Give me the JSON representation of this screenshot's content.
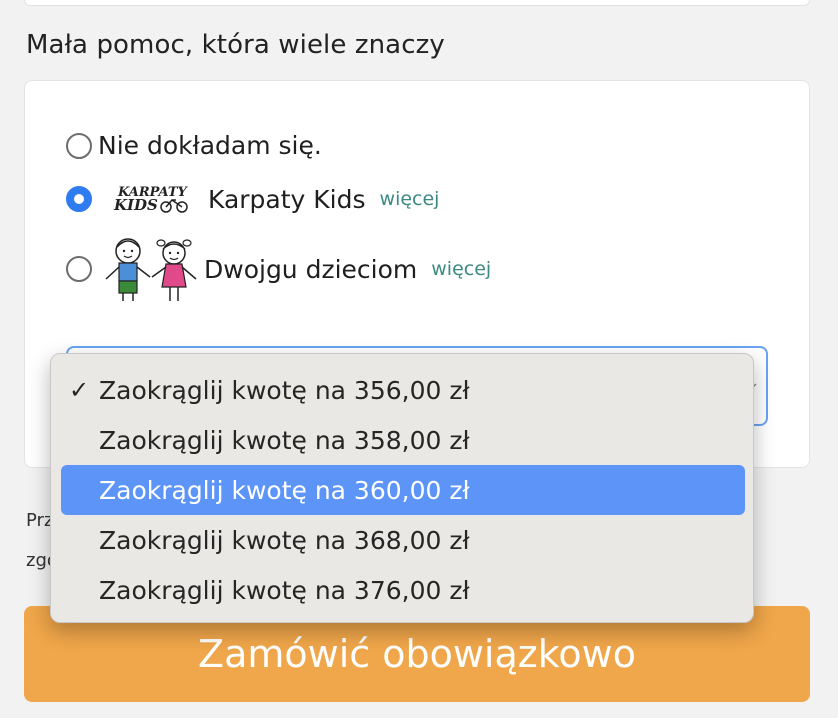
{
  "section": {
    "title": "Mała pomoc, która wiele znaczy"
  },
  "donation": {
    "options": [
      {
        "label": "Nie dokładam się.",
        "checked": false
      },
      {
        "label": "Karpaty Kids",
        "more": "więcej",
        "checked": true,
        "logo_text": [
          "KARPATY",
          "KIDS"
        ]
      },
      {
        "label": "Dwojgu dzieciom",
        "more": "więcej",
        "checked": false
      }
    ]
  },
  "rounding_select": {
    "selected_index": 0,
    "highlighted_index": 2,
    "options": [
      "Zaokrąglij kwotę na 356,00 zł",
      "Zaokrąglij kwotę na 358,00 zł",
      "Zaokrąglij kwotę na 360,00 zł",
      "Zaokrąglij kwotę na 368,00 zł",
      "Zaokrąglij kwotę na 376,00 zł"
    ],
    "check_glyph": "✓"
  },
  "legal": {
    "line1": "Prz",
    "line2": "zgo"
  },
  "order_button": {
    "label": "Zamówić obowiązkowo"
  },
  "colors": {
    "accent_radio": "#2f7bf0",
    "link": "#3d8a85",
    "button": "#f0a64a",
    "highlight": "#5c95f7"
  }
}
